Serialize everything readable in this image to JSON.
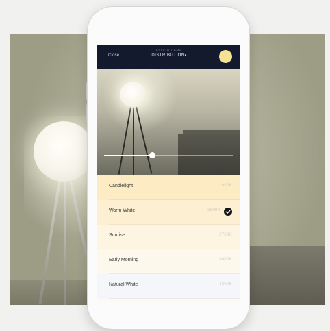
{
  "navbar": {
    "close_label": "Close",
    "subtitle": "FLOOR LAMP",
    "title": "DISTRIBUTION",
    "caret": "▾",
    "sun_color": "#f4e394",
    "bg_color": "#141a2e"
  },
  "slider": {
    "level": 0.37
  },
  "temperatures": [
    {
      "label": "Candlelight",
      "value": "1900K",
      "bg": "#fdebc3",
      "selected": false
    },
    {
      "label": "Warm White",
      "value": "2300K",
      "bg": "#fdf0d2",
      "selected": true
    },
    {
      "label": "Sunrise",
      "value": "2700K",
      "bg": "#fdf5e1",
      "selected": false
    },
    {
      "label": "Early Morning",
      "value": "3000K",
      "bg": "#fcf8ec",
      "selected": false
    },
    {
      "label": "Natural White",
      "value": "4200K",
      "bg": "#f4f6fa",
      "selected": false
    }
  ],
  "icons": {
    "check": "check-icon",
    "sun": "sun-icon"
  }
}
